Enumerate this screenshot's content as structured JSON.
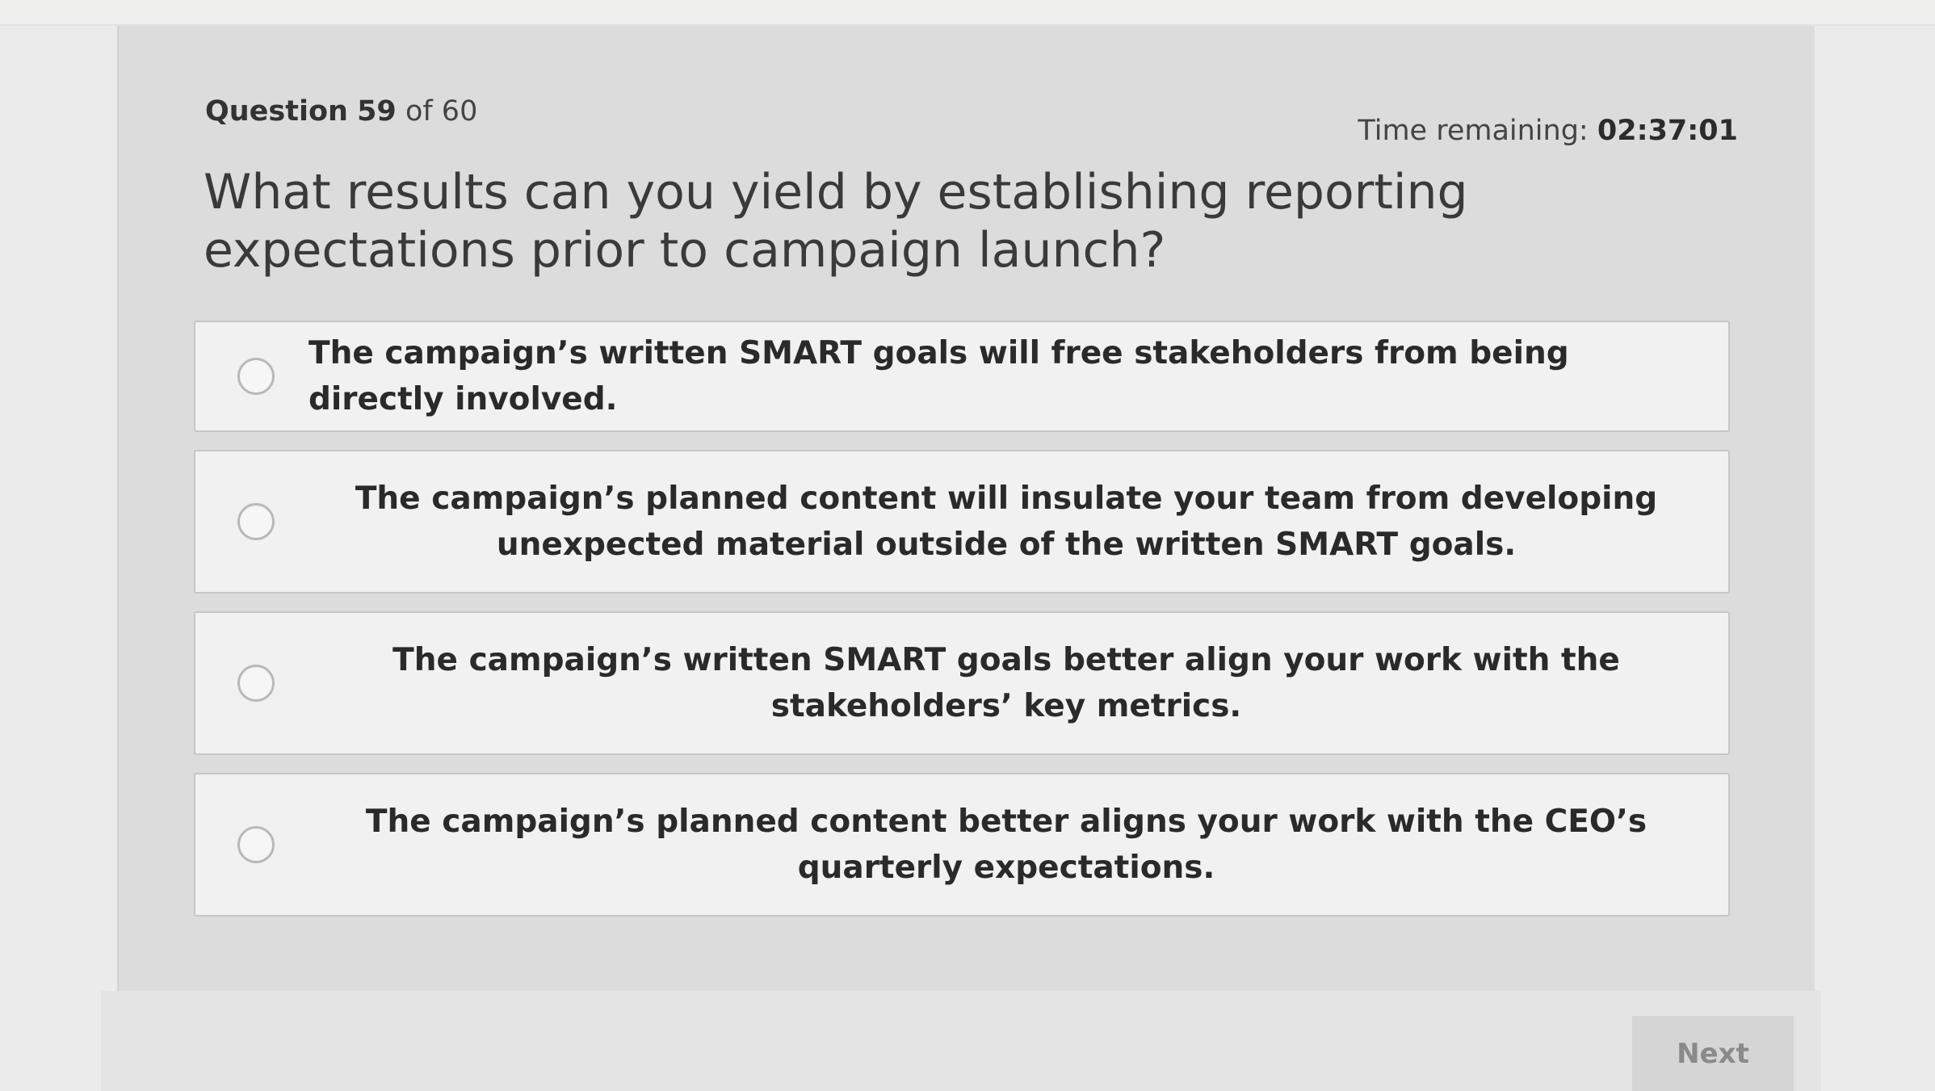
{
  "header": {
    "question_label": "Question",
    "question_number": "59",
    "question_of": "of 60",
    "time_label": "Time remaining:",
    "time_value": "02:37:01"
  },
  "question": {
    "text": "What results can you yield by establishing reporting expectations prior to campaign launch?"
  },
  "options": [
    {
      "label": "The campaign’s written SMART goals will free stakeholders from being directly involved."
    },
    {
      "label": "The campaign’s planned content will insulate your team from developing unexpected material outside of the written SMART goals."
    },
    {
      "label": "The campaign’s written SMART goals better align your work with the stakeholders’ key metrics."
    },
    {
      "label": "The campaign’s planned content better aligns your work with the CEO’s quarterly expectations."
    }
  ],
  "footer": {
    "next_label": "Next"
  },
  "colors": {
    "panel_bg": "#dcdcdc",
    "option_bg": "#f1f1f1",
    "radio_border": "#b9b9b9",
    "text_dark": "#2a2a2a"
  },
  "icons": {
    "radio": "radio-unselected-icon"
  }
}
